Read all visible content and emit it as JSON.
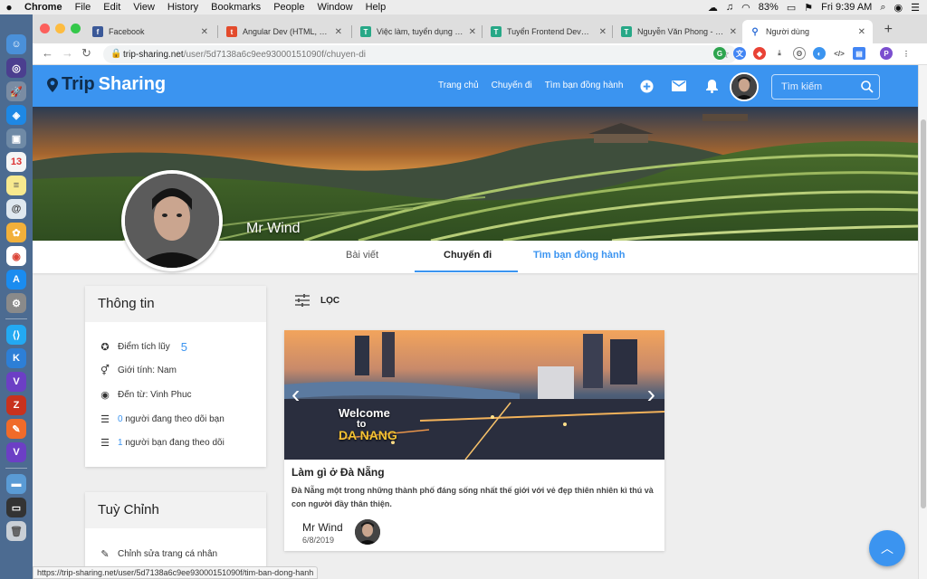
{
  "menubar": {
    "app": "Chrome",
    "items": [
      "File",
      "Edit",
      "View",
      "History",
      "Bookmarks",
      "People",
      "Window",
      "Help"
    ],
    "battery": "83%",
    "clock": "Fri 9:39 AM"
  },
  "tabs": [
    {
      "label": "Facebook",
      "favicon": "facebook-icon",
      "color": "#3b5998",
      "glyph": "f"
    },
    {
      "label": "Angular Dev (HTML, Java",
      "favicon": "topcv-icon",
      "color": "#e34b2c",
      "glyph": "t"
    },
    {
      "label": "Việc làm, tuyển dụng Lậ",
      "favicon": "itviec-icon",
      "color": "#27a887",
      "glyph": "T"
    },
    {
      "label": "Tuyển Frontend Develop",
      "favicon": "itviec-icon",
      "color": "#27a887",
      "glyph": "T"
    },
    {
      "label": "Nguyễn Văn Phong - lập",
      "favicon": "itviec-icon",
      "color": "#27a887",
      "glyph": "T"
    },
    {
      "label": "Người dùng",
      "favicon": "location-pin-icon",
      "color": "#2a6bd6",
      "glyph": "◉"
    }
  ],
  "address": {
    "host": "trip-sharing.net",
    "path": "/user/5d7138a6c9ee93000151090f/chuyen-di"
  },
  "site": {
    "logo_trip": "Trip",
    "logo_sharing": "Sharing",
    "nav": [
      "Trang chủ",
      "Chuyến đi",
      "Tìm bạn đồng hành"
    ],
    "search_placeholder": "Tìm kiếm"
  },
  "profile": {
    "name": "Mr Wind",
    "tabs": [
      "Bài viết",
      "Chuyến đi",
      "Tìm bạn đồng hành"
    ]
  },
  "info_card": {
    "title": "Thông tin",
    "points_label": "Điểm tích lũy",
    "points_value": "5",
    "gender": "Giới tính: Nam",
    "from": "Đến từ: Vinh Phuc",
    "followers_count": "0",
    "followers_label": "người đang theo dõi bạn",
    "following_count": "1",
    "following_label": "người bạn đang theo dõi"
  },
  "custom_card": {
    "title": "Tuỳ Chỉnh",
    "edit_label": "Chỉnh sửa trang cá nhân"
  },
  "filter_label": "LỌC",
  "post": {
    "image_text_1": "Welcome",
    "image_text_2": "to",
    "image_text_3": "DA NANG",
    "title": "Làm gì ở Đà Nẵng",
    "description": "Đà Nẵng một trong những thành phố đáng sống nhất thế giới với vẻ đẹp thiên nhiên kì thú và con người đầy thân thiện.",
    "author": "Mr Wind",
    "date": "6/8/2019"
  },
  "status_url": "https://trip-sharing.net/user/5d7138a6c9ee93000151090f/tim-ban-dong-hanh",
  "colors": {
    "brand": "#3b94f0",
    "logo_dark": "#0f2d4d"
  }
}
